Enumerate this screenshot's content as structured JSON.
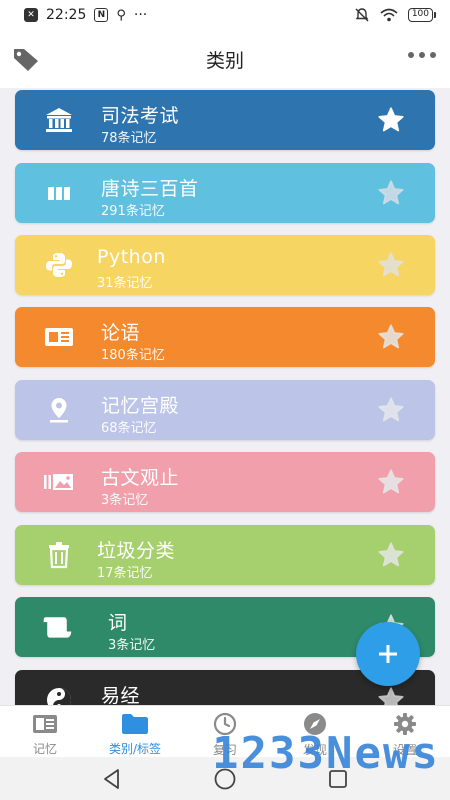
{
  "status_bar": {
    "time": "22:25",
    "dots": "···",
    "battery": "100"
  },
  "header": {
    "title": "类别"
  },
  "categories": [
    {
      "title": "司法考试",
      "count": "78条记忆",
      "color": "#2e75b0",
      "icon": "bank-icon",
      "starred": true
    },
    {
      "title": "唐诗三百首",
      "count": "291条记忆",
      "color": "#5fc0df",
      "icon": "columns-icon",
      "starred": false
    },
    {
      "title": "Python",
      "count": "31条记忆",
      "color": "#f7d562",
      "icon": "python-icon",
      "starred": false
    },
    {
      "title": "论语",
      "count": "180条记忆",
      "color": "#f4892e",
      "icon": "newspaper-icon",
      "starred": false
    },
    {
      "title": "记忆宫殿",
      "count": "68条记忆",
      "color": "#bcc5e8",
      "icon": "map-pin-icon",
      "starred": false
    },
    {
      "title": "古文观止",
      "count": "3条记忆",
      "color": "#f1a0ab",
      "icon": "image-gallery-icon",
      "starred": false
    },
    {
      "title": "垃圾分类",
      "count": "17条记忆",
      "color": "#a6cf6e",
      "icon": "trash-icon",
      "starred": false
    },
    {
      "title": "词",
      "count": "3条记忆",
      "color": "#2e8a68",
      "icon": "scroll-icon",
      "starred": false
    },
    {
      "title": "易经",
      "count": "",
      "color": "#2a2a2a",
      "icon": "yin-yang-icon",
      "starred": false
    }
  ],
  "nav": [
    {
      "label": "记忆",
      "icon": "memory-card-icon",
      "active": false
    },
    {
      "label": "类别/标签",
      "icon": "folder-icon",
      "active": true
    },
    {
      "label": "复习",
      "icon": "clock-icon",
      "active": false
    },
    {
      "label": "发现",
      "icon": "compass-icon",
      "active": false
    },
    {
      "label": "设置",
      "icon": "gear-icon",
      "active": false
    }
  ],
  "watermark": "1233News"
}
